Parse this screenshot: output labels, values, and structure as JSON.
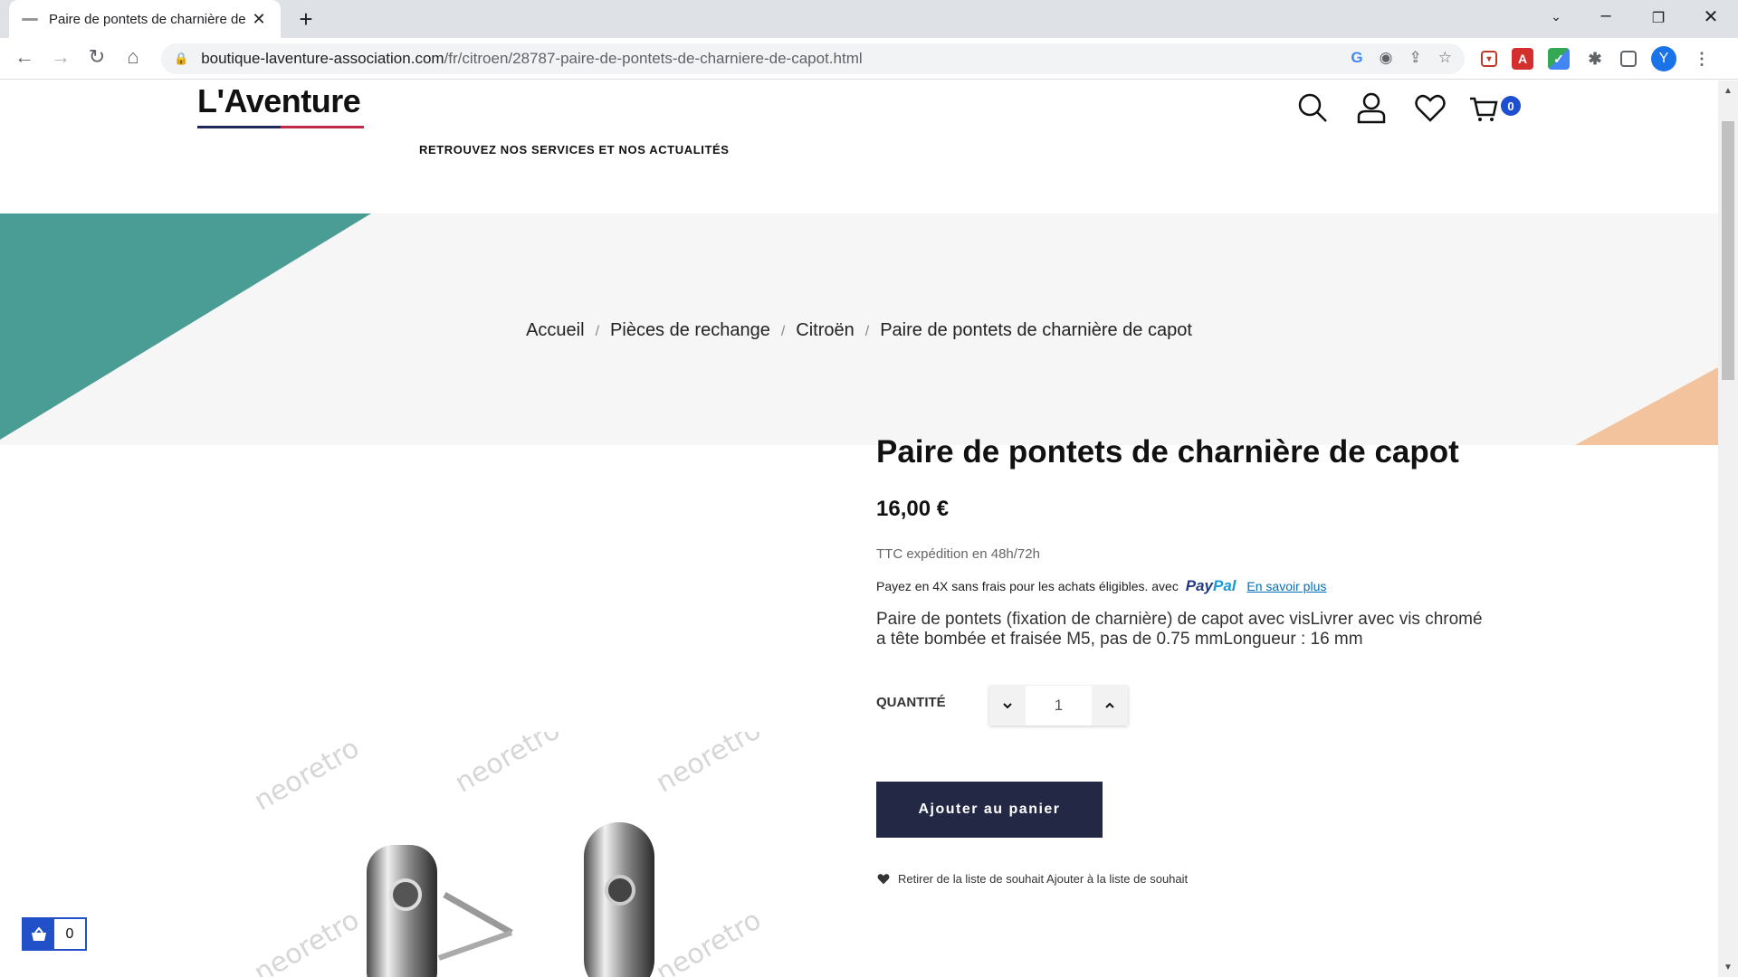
{
  "browser": {
    "tab_title": "Paire de pontets de charnière de",
    "url_host": "boutique-laventure-association.com",
    "url_path": "/fr/citroen/28787-paire-de-pontets-de-charniere-de-capot.html",
    "avatar_letter": "Y"
  },
  "header": {
    "logo": "L'Aventure",
    "nav_link": "RETROUVEZ NOS SERVICES ET NOS ACTUALITÉS",
    "cart_count": "0"
  },
  "breadcrumb": {
    "items": [
      "Accueil",
      "Pièces de rechange",
      "Citroën",
      "Paire de pontets de charnière de capot"
    ],
    "separator": "/"
  },
  "product": {
    "title": "Paire de pontets de charnière de capot",
    "price": "16,00 €",
    "tax_note": "TTC expédition en 48h/72h",
    "paypal_text": "Payez en 4X sans frais pour les achats éligibles. avec",
    "paypal_logo_pay": "Pay",
    "paypal_logo_pal": "Pal",
    "paypal_more": "En savoir plus",
    "description": "Paire de pontets (fixation de charnière) de capot avec visLivrer avec vis chromé a tête bombée et fraisée M5, pas de 0.75 mmLongueur : 16 mm",
    "quantity_label": "QUANTITÉ",
    "quantity_value": "1",
    "add_to_cart": "Ajouter au panier",
    "wishlist_text": "Retirer de la liste de souhait Ajouter à la liste de souhait",
    "watermark": "neoretro"
  },
  "floating_basket": {
    "count": "0"
  },
  "colors": {
    "teal": "#4a9d94",
    "peach": "#f2c39c",
    "button_navy": "#232845",
    "accent_blue": "#2150c9"
  }
}
